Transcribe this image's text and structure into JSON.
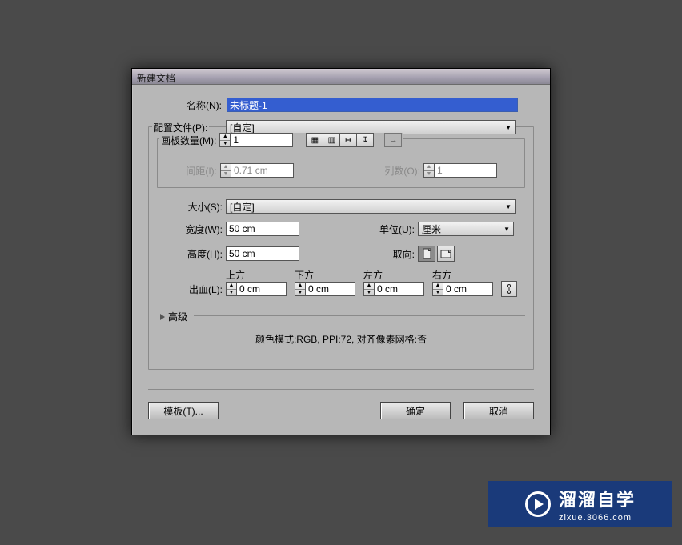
{
  "dialog": {
    "title": "新建文档",
    "name_label": "名称(N):",
    "name_value": "未标题-1",
    "profile_label": "配置文件(P):",
    "profile_value": "[自定]",
    "artboard_count_label": "画板数量(M):",
    "artboard_count_value": "1",
    "spacing_label": "间距(I):",
    "spacing_value": "0.71 cm",
    "columns_label": "列数(O):",
    "columns_value": "1",
    "size_label": "大小(S):",
    "size_value": "[自定]",
    "width_label": "宽度(W):",
    "width_value": "50 cm",
    "units_label": "单位(U):",
    "units_value": "厘米",
    "height_label": "高度(H):",
    "height_value": "50 cm",
    "orientation_label": "取向:",
    "bleed_label": "出血(L):",
    "bleed_top_label": "上方",
    "bleed_bottom_label": "下方",
    "bleed_left_label": "左方",
    "bleed_right_label": "右方",
    "bleed_value": "0 cm",
    "advanced_label": "高级",
    "summary_text": "颜色模式:RGB, PPI:72, 对齐像素网格:否",
    "template_btn": "模板(T)...",
    "ok_btn": "确定",
    "cancel_btn": "取消"
  },
  "watermark": {
    "title": "溜溜自学",
    "subtitle": "zixue.3066.com"
  }
}
